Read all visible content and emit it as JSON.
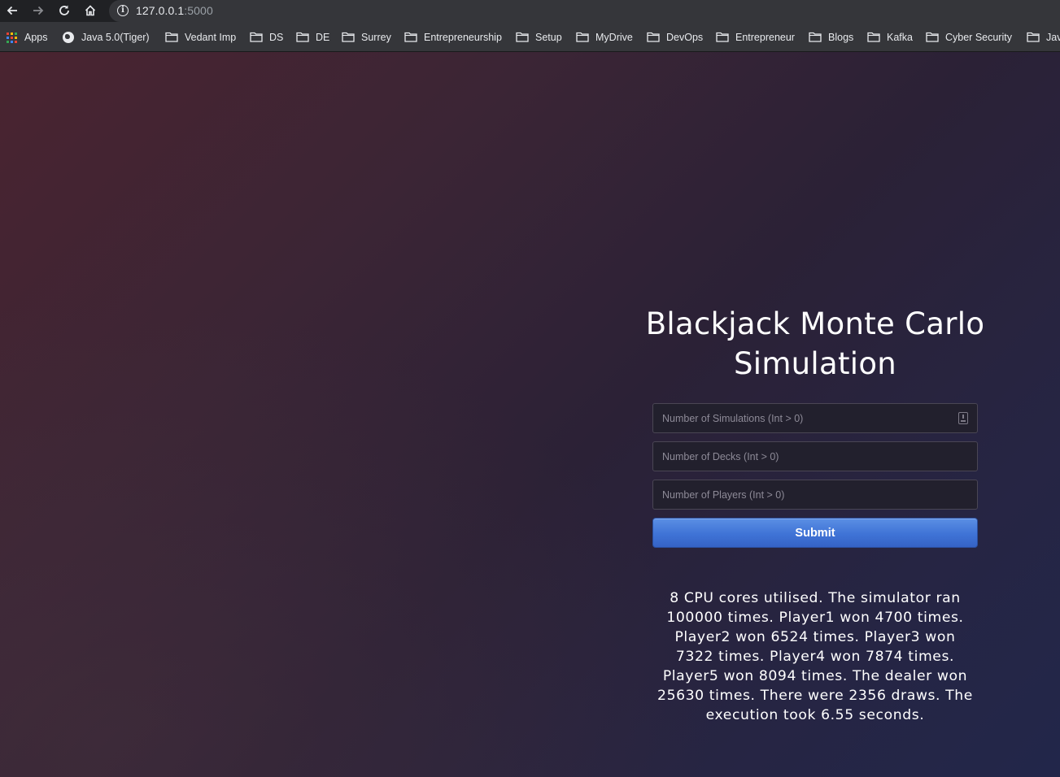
{
  "browser": {
    "url_host": "127.0.0.1",
    "url_port": ":5000",
    "bookmarks": [
      {
        "label": "Apps",
        "icon": "apps-grid-icon"
      },
      {
        "label": "Java 5.0(Tiger)",
        "icon": "globe-icon"
      },
      {
        "label": "Vedant Imp",
        "icon": "folder-icon"
      },
      {
        "label": "DS",
        "icon": "folder-icon"
      },
      {
        "label": "DE",
        "icon": "folder-icon"
      },
      {
        "label": "Surrey",
        "icon": "folder-icon"
      },
      {
        "label": "Entrepreneurship",
        "icon": "folder-icon"
      },
      {
        "label": "Setup",
        "icon": "folder-icon"
      },
      {
        "label": "MyDrive",
        "icon": "folder-icon"
      },
      {
        "label": "DevOps",
        "icon": "folder-icon"
      },
      {
        "label": "Entrepreneur",
        "icon": "folder-icon"
      },
      {
        "label": "Blogs",
        "icon": "folder-icon"
      },
      {
        "label": "Kafka",
        "icon": "folder-icon"
      },
      {
        "label": "Cyber Security",
        "icon": "folder-icon"
      },
      {
        "label": "Jav",
        "icon": "folder-icon"
      }
    ]
  },
  "page": {
    "title_line1": "Blackjack Monte Carlo",
    "title_line2": "Simulation",
    "form": {
      "simulations_placeholder": "Number of Simulations (Int > 0)",
      "decks_placeholder": "Number of Decks (Int > 0)",
      "players_placeholder": "Number of Players (Int > 0)",
      "submit_label": "Submit"
    },
    "result_lines": [
      "8 CPU cores utilised. The simulator ran",
      "100000 times. Player1 won 4700 times.",
      "Player2 won 6524 times. Player3 won",
      "7322 times. Player4 won 7874 times.",
      "Player5 won 8094 times. The dealer won",
      "25630 times. There were 2356 draws. The",
      "execution took 6.55 seconds."
    ]
  },
  "colors": {
    "submit_button": "#3f73d6",
    "page_gradient_start": "#4a2430",
    "page_gradient_end": "#22264a"
  }
}
